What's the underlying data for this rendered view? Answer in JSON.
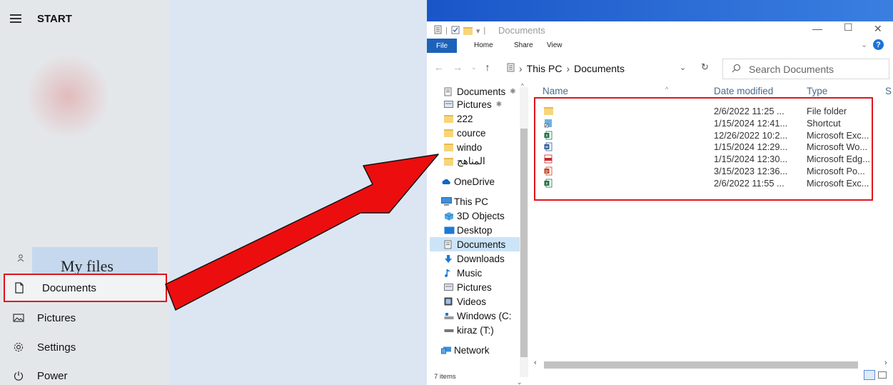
{
  "start_menu": {
    "title": "START",
    "tile_label": "My files",
    "items": [
      {
        "label": "Documents",
        "icon": "document-icon"
      },
      {
        "label": "Pictures",
        "icon": "picture-icon"
      },
      {
        "label": "Settings",
        "icon": "gear-icon"
      },
      {
        "label": "Power",
        "icon": "power-icon"
      }
    ]
  },
  "explorer": {
    "title": "Documents",
    "ribbon_tabs": [
      "File",
      "Home",
      "Share",
      "View"
    ],
    "address": [
      "This PC",
      "Documents"
    ],
    "search_placeholder": "Search Documents",
    "nav": [
      {
        "label": "Documents",
        "icon": "documents-icon",
        "pinned": true
      },
      {
        "label": "Pictures",
        "icon": "pictures-icon",
        "pinned": true
      },
      {
        "label": "222",
        "icon": "folder-icon"
      },
      {
        "label": "cource",
        "icon": "folder-icon"
      },
      {
        "label": "windo",
        "icon": "folder-icon"
      },
      {
        "label": "المناهج",
        "icon": "folder-icon"
      },
      {
        "label": "OneDrive",
        "icon": "onedrive-icon"
      },
      {
        "label": "This PC",
        "icon": "computer-icon"
      },
      {
        "label": "3D Objects",
        "icon": "3d-objects-icon"
      },
      {
        "label": "Desktop",
        "icon": "desktop-icon"
      },
      {
        "label": "Documents",
        "icon": "documents-icon",
        "selected": true
      },
      {
        "label": "Downloads",
        "icon": "downloads-icon"
      },
      {
        "label": "Music",
        "icon": "music-icon"
      },
      {
        "label": "Pictures",
        "icon": "pictures-icon"
      },
      {
        "label": "Videos",
        "icon": "videos-icon"
      },
      {
        "label": "Windows (C:",
        "icon": "drive-icon"
      },
      {
        "label": "kiraz (T:)",
        "icon": "drive-icon"
      },
      {
        "label": "Network",
        "icon": "network-icon"
      }
    ],
    "columns": {
      "name": "Name",
      "date": "Date modified",
      "type": "Type",
      "size": "S"
    },
    "files": [
      {
        "icon": "folder-icon",
        "date": "2/6/2022 11:25 ...",
        "type": "File folder"
      },
      {
        "icon": "shortcut-icon",
        "date": "1/15/2024 12:41...",
        "type": "Shortcut"
      },
      {
        "icon": "excel-icon",
        "date": "12/26/2022 10:2...",
        "type": "Microsoft Exc..."
      },
      {
        "icon": "word-icon",
        "date": "1/15/2024 12:29...",
        "type": "Microsoft Wo..."
      },
      {
        "icon": "pdf-icon",
        "date": "1/15/2024 12:30...",
        "type": "Microsoft Edg..."
      },
      {
        "icon": "powerpoint-icon",
        "date": "3/15/2023 12:36...",
        "type": "Microsoft Po..."
      },
      {
        "icon": "excel-icon",
        "date": "2/6/2022 11:55 ...",
        "type": "Microsoft Exc..."
      }
    ],
    "status": "7 items"
  },
  "colors": {
    "highlight_red": "#e0141b",
    "file_tab_blue": "#1c62b9",
    "selected_nav": "#cce4f7"
  }
}
